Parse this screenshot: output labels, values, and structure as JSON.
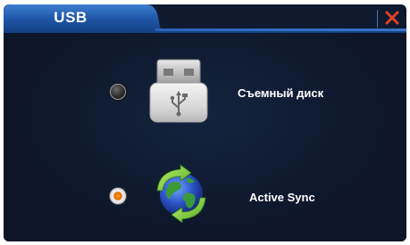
{
  "dialog": {
    "tab_label": "USB",
    "close_symbol": "✕"
  },
  "options": [
    {
      "label": "Съемный диск",
      "icon": "usb-drive-icon",
      "selected": false
    },
    {
      "label": "Active Sync",
      "icon": "active-sync-globe-icon",
      "selected": true
    }
  ],
  "colors": {
    "background": "#0f1a2e",
    "tab": "#1d4f9c",
    "close": "#e0402a",
    "radio_selected": "#ff8c1a"
  }
}
